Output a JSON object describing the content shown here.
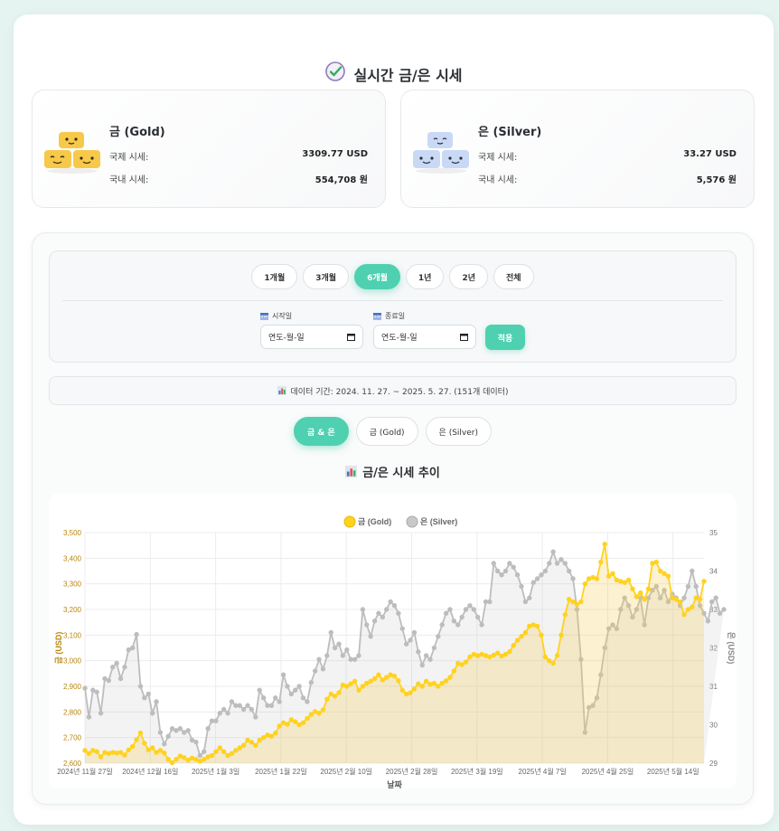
{
  "header": {
    "title": "실시간 금/은 시세",
    "icon": "check-badge-icon"
  },
  "gold_card": {
    "name": "금 (Gold)",
    "intl_label": "국제 시세:",
    "intl_value": "3309.77 USD",
    "dom_label": "국내 시세:",
    "dom_value": "554,708 원",
    "color": "#f4c430"
  },
  "silver_card": {
    "name": "은 (Silver)",
    "intl_label": "국제 시세:",
    "intl_value": "33.27 USD",
    "dom_label": "국내 시세:",
    "dom_value": "5,576 원",
    "color": "#c8d8f4"
  },
  "period_buttons": [
    {
      "label": "1개월",
      "active": false
    },
    {
      "label": "3개월",
      "active": false
    },
    {
      "label": "6개월",
      "active": true
    },
    {
      "label": "1년",
      "active": false
    },
    {
      "label": "2년",
      "active": false
    },
    {
      "label": "전체",
      "active": false
    }
  ],
  "date_filter": {
    "start_label": "시작일",
    "end_label": "종료일",
    "start_value": "연도-월-일",
    "end_value": "연도-월-일",
    "apply_label": "적용"
  },
  "data_info": "데이터 기간: 2024. 11. 27. ~ 2025. 5. 27. (151개 데이터)",
  "metal_tabs": [
    {
      "label": "금 & 은",
      "active": true
    },
    {
      "label": "금 (Gold)",
      "active": false
    },
    {
      "label": "은 (Silver)",
      "active": false
    }
  ],
  "chart_title": "금/은 시세 추이",
  "accent_color": "#4fd0b0",
  "chart_data": {
    "type": "line",
    "xlabel": "날짜",
    "y_left_label": "금 (USD)",
    "y_right_label": "은 (USD)",
    "y_left_range": [
      2600,
      3500
    ],
    "y_right_range": [
      29,
      35
    ],
    "y_left_ticks": [
      "2,600",
      "2,700",
      "2,800",
      "2,900",
      "3,000",
      "3,100",
      "3,200",
      "3,300",
      "3,400",
      "3,500"
    ],
    "y_right_ticks": [
      "29",
      "30",
      "31",
      "32",
      "33",
      "34",
      "35"
    ],
    "x_tick_labels": [
      "2024년 11월 27일",
      "2024년 12월 16일",
      "2025년 1월 3일",
      "2025년 1월 22일",
      "2025년 2월 10일",
      "2025년 2월 28일",
      "2025년 3월 19일",
      "2025년 4월 7일",
      "2025년 4월 25일",
      "2025년 5월 14일"
    ],
    "legend_placement": "top-center",
    "grid": true,
    "series": [
      {
        "name": "금 (Gold)",
        "axis": "left",
        "color": "#ffd21f",
        "fill": "rgba(244,206,90,0.28)",
        "values": [
          2650,
          2638,
          2650,
          2645,
          2625,
          2642,
          2638,
          2642,
          2640,
          2642,
          2632,
          2652,
          2665,
          2692,
          2718,
          2678,
          2652,
          2660,
          2642,
          2650,
          2640,
          2615,
          2602,
          2615,
          2628,
          2622,
          2612,
          2620,
          2615,
          2608,
          2615,
          2625,
          2630,
          2645,
          2660,
          2645,
          2630,
          2638,
          2650,
          2660,
          2670,
          2690,
          2682,
          2670,
          2690,
          2700,
          2710,
          2705,
          2718,
          2745,
          2758,
          2752,
          2770,
          2762,
          2750,
          2758,
          2775,
          2790,
          2802,
          2795,
          2808,
          2850,
          2870,
          2862,
          2875,
          2905,
          2900,
          2910,
          2920,
          2885,
          2900,
          2912,
          2920,
          2930,
          2945,
          2925,
          2935,
          2945,
          2940,
          2922,
          2885,
          2870,
          2875,
          2890,
          2910,
          2900,
          2920,
          2908,
          2912,
          2900,
          2912,
          2922,
          2935,
          2960,
          2990,
          2985,
          2995,
          3015,
          3025,
          3020,
          3025,
          3020,
          3015,
          3022,
          3030,
          3018,
          3025,
          3035,
          3060,
          3080,
          3095,
          3110,
          3135,
          3140,
          3135,
          3100,
          3015,
          3000,
          2990,
          3020,
          3100,
          3180,
          3240,
          3230,
          3220,
          3230,
          3300,
          3320,
          3325,
          3320,
          3385,
          3455,
          3330,
          3340,
          3315,
          3310,
          3305,
          3315,
          3280,
          3250,
          3265,
          3240,
          3280,
          3380,
          3385,
          3350,
          3340,
          3330,
          3245,
          3240,
          3230,
          3180,
          3200,
          3210,
          3245,
          3240,
          3310
        ]
      },
      {
        "name": "은 (Silver)",
        "axis": "right",
        "color": "#bdbdbd",
        "fill": "rgba(200,200,200,0.22)",
        "values": [
          30.95,
          30.2,
          30.9,
          30.85,
          30.3,
          31.2,
          31.15,
          31.5,
          31.6,
          31.2,
          31.5,
          31.95,
          32.0,
          32.35,
          31.0,
          30.7,
          30.8,
          30.3,
          30.6,
          29.8,
          29.5,
          29.7,
          29.9,
          29.85,
          29.9,
          29.8,
          29.85,
          29.6,
          29.55,
          29.2,
          29.3,
          29.9,
          30.1,
          30.1,
          30.3,
          30.4,
          30.3,
          30.6,
          30.5,
          30.5,
          30.4,
          30.5,
          30.4,
          30.2,
          30.9,
          30.7,
          30.5,
          30.5,
          30.7,
          30.6,
          31.3,
          31.0,
          30.8,
          30.9,
          31.0,
          30.7,
          30.6,
          31.1,
          31.4,
          31.7,
          31.45,
          31.8,
          32.4,
          32.0,
          32.1,
          31.8,
          31.95,
          31.7,
          31.7,
          31.8,
          33.0,
          32.6,
          32.3,
          32.7,
          32.9,
          32.8,
          33.0,
          33.2,
          33.1,
          32.9,
          32.5,
          32.1,
          32.2,
          32.4,
          31.9,
          31.55,
          31.8,
          31.7,
          32.0,
          32.3,
          32.6,
          32.9,
          33.0,
          32.7,
          32.6,
          32.8,
          33.0,
          33.1,
          33.0,
          32.8,
          32.6,
          33.2,
          33.2,
          34.2,
          34.0,
          33.9,
          34.0,
          34.2,
          34.1,
          33.9,
          33.6,
          33.2,
          33.3,
          33.7,
          33.8,
          33.9,
          34.0,
          34.2,
          34.5,
          34.2,
          34.3,
          34.2,
          34.0,
          33.8,
          33.0,
          31.7,
          29.8,
          30.45,
          30.5,
          30.7,
          31.3,
          32.0,
          32.5,
          32.6,
          32.5,
          33.0,
          33.3,
          33.1,
          32.8,
          33.0,
          33.3,
          32.6,
          33.3,
          33.5,
          33.6,
          33.3,
          33.5,
          33.2,
          33.4,
          33.3,
          33.1,
          33.3,
          33.6,
          34.0,
          33.6,
          33.1,
          32.9,
          32.7,
          33.2,
          33.3,
          32.9,
          33.0
        ]
      }
    ]
  }
}
